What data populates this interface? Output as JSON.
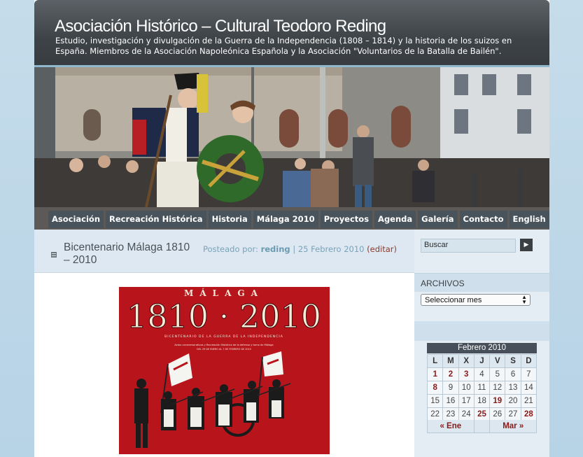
{
  "header": {
    "title": "Asociación Histórico – Cultural Teodoro Reding",
    "description": "Estudio, investigación y divulgación de la Guerra de la Independencia (1808 – 1814) y la historia de los suizos en España. Miembros de la Asociación Napoleónica Española y la Asociación \"Voluntarios de la Batalla de Bailén\"."
  },
  "nav": [
    {
      "label": "Asociación"
    },
    {
      "label": "Recreación Histórica"
    },
    {
      "label": "Historia"
    },
    {
      "label": "Málaga 2010"
    },
    {
      "label": "Proyectos"
    },
    {
      "label": "Agenda"
    },
    {
      "label": "Galería"
    },
    {
      "label": "Contacto"
    },
    {
      "label": "English"
    }
  ],
  "post": {
    "title": "Bicentenario Málaga 1810 – 2010",
    "posted_by": "Posteado por:",
    "author": "reding",
    "separator": "|",
    "date": "25 Febrero 2010",
    "edit": "(editar)",
    "poster": {
      "city": "MÁLAGA",
      "years": "1810 · 2010",
      "subtitle": "BICENTENARIO DE LA GUERRA DE LA INDEPENDENCIA",
      "line1": "Actos conmemorativos y Recreación Histórica de la defensa y toma de Málaga",
      "line2": "DEL 29 DE ENERO AL 7 DE FEBRERO DE 2010"
    }
  },
  "sidebar": {
    "search_value": "Buscar",
    "search_button": "▶",
    "archive_title": "ARCHIVOS",
    "archive_select": "Seleccionar mes",
    "calendar": {
      "caption": "Febrero 2010",
      "days": [
        "L",
        "M",
        "X",
        "J",
        "V",
        "S",
        "D"
      ],
      "weeks": [
        [
          {
            "d": "1",
            "link": true
          },
          {
            "d": "2",
            "link": true
          },
          {
            "d": "3",
            "link": true
          },
          {
            "d": "4"
          },
          {
            "d": "5"
          },
          {
            "d": "6"
          },
          {
            "d": "7"
          }
        ],
        [
          {
            "d": "8",
            "link": true
          },
          {
            "d": "9"
          },
          {
            "d": "10"
          },
          {
            "d": "11"
          },
          {
            "d": "12"
          },
          {
            "d": "13"
          },
          {
            "d": "14"
          }
        ],
        [
          {
            "d": "15"
          },
          {
            "d": "16"
          },
          {
            "d": "17"
          },
          {
            "d": "18"
          },
          {
            "d": "19",
            "link": true
          },
          {
            "d": "20"
          },
          {
            "d": "21"
          }
        ],
        [
          {
            "d": "22"
          },
          {
            "d": "23"
          },
          {
            "d": "24"
          },
          {
            "d": "25",
            "link": true
          },
          {
            "d": "26"
          },
          {
            "d": "27"
          },
          {
            "d": "28",
            "link": true
          }
        ]
      ],
      "prev": "« Ene",
      "next": "Mar »"
    }
  },
  "colors": {
    "header_bg": "#3e4347",
    "page_bg": "#c5dcea",
    "link_red": "#8a1a1a",
    "meta_blue": "#7aa3b8",
    "poster_red": "#b8141c"
  }
}
